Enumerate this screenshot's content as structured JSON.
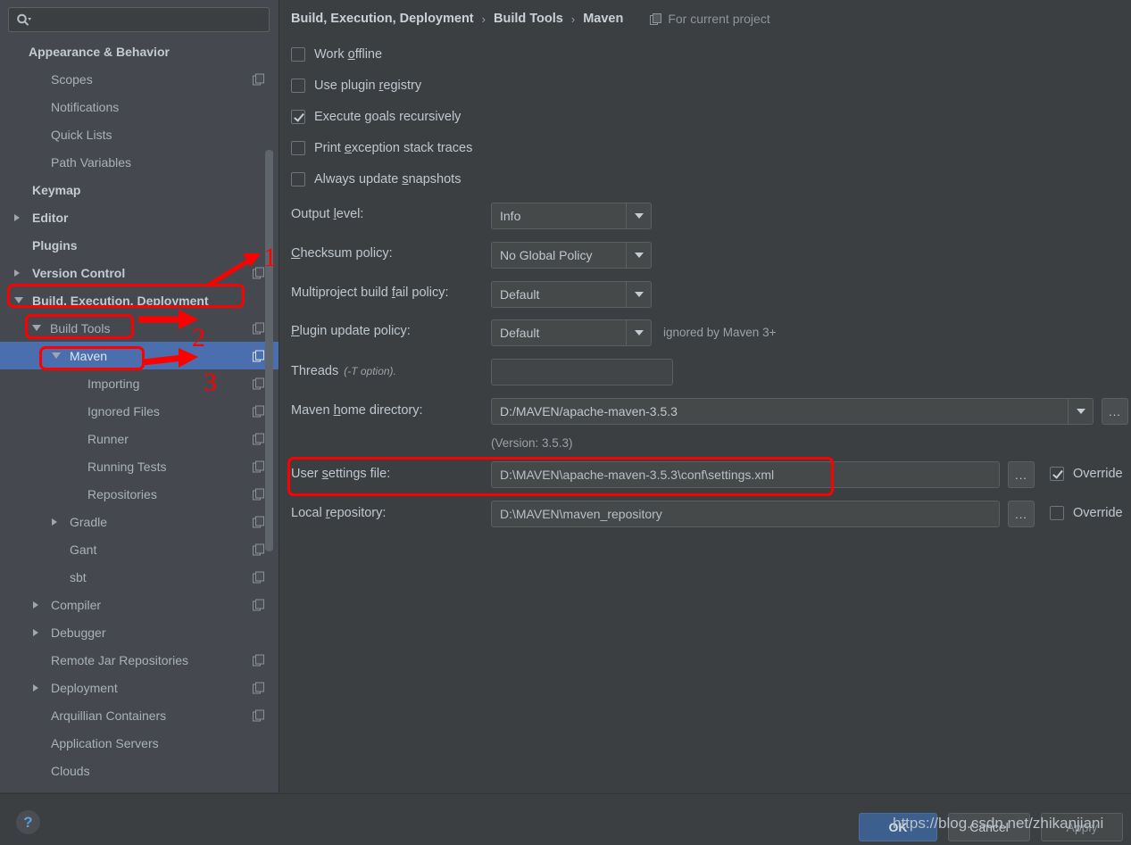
{
  "search": {
    "placeholder": "",
    "value": "",
    "icon": "search-icon"
  },
  "sidebar": {
    "items": [
      {
        "label": "Appearance & Behavior",
        "indent": 32,
        "bold": true,
        "arrow": "none",
        "copy": false
      },
      {
        "label": "Scopes",
        "indent": 57,
        "bold": false,
        "arrow": "none",
        "copy": true
      },
      {
        "label": "Notifications",
        "indent": 57,
        "bold": false,
        "arrow": "none",
        "copy": false
      },
      {
        "label": "Quick Lists",
        "indent": 57,
        "bold": false,
        "arrow": "none",
        "copy": false
      },
      {
        "label": "Path Variables",
        "indent": 57,
        "bold": false,
        "arrow": "none",
        "copy": false
      },
      {
        "label": "Keymap",
        "indent": 36,
        "bold": true,
        "arrow": "none",
        "copy": false
      },
      {
        "label": "Editor",
        "indent": 36,
        "bold": true,
        "arrow": "right",
        "copy": false
      },
      {
        "label": "Plugins",
        "indent": 36,
        "bold": true,
        "arrow": "none",
        "copy": false
      },
      {
        "label": "Version Control",
        "indent": 36,
        "bold": true,
        "arrow": "right",
        "copy": true
      },
      {
        "label": "Build, Execution, Deployment",
        "indent": 36,
        "bold": true,
        "arrow": "down",
        "copy": false
      },
      {
        "label": "Build Tools",
        "indent": 56,
        "bold": false,
        "arrow": "down",
        "copy": true
      },
      {
        "label": "Maven",
        "indent": 78,
        "bold": false,
        "arrow": "down",
        "copy": true,
        "selected": true
      },
      {
        "label": "Importing",
        "indent": 98,
        "bold": false,
        "arrow": "none",
        "copy": true
      },
      {
        "label": "Ignored Files",
        "indent": 98,
        "bold": false,
        "arrow": "none",
        "copy": true
      },
      {
        "label": "Runner",
        "indent": 98,
        "bold": false,
        "arrow": "none",
        "copy": true
      },
      {
        "label": "Running Tests",
        "indent": 98,
        "bold": false,
        "arrow": "none",
        "copy": true
      },
      {
        "label": "Repositories",
        "indent": 98,
        "bold": false,
        "arrow": "none",
        "copy": true
      },
      {
        "label": "Gradle",
        "indent": 78,
        "bold": false,
        "arrow": "right",
        "copy": true
      },
      {
        "label": "Gant",
        "indent": 78,
        "bold": false,
        "arrow": "none",
        "copy": true
      },
      {
        "label": "sbt",
        "indent": 78,
        "bold": false,
        "arrow": "none",
        "copy": true
      },
      {
        "label": "Compiler",
        "indent": 57,
        "bold": false,
        "arrow": "right",
        "copy": true
      },
      {
        "label": "Debugger",
        "indent": 57,
        "bold": false,
        "arrow": "right",
        "copy": false
      },
      {
        "label": "Remote Jar Repositories",
        "indent": 57,
        "bold": false,
        "arrow": "none",
        "copy": true
      },
      {
        "label": "Deployment",
        "indent": 57,
        "bold": false,
        "arrow": "right",
        "copy": true
      },
      {
        "label": "Arquillian Containers",
        "indent": 57,
        "bold": false,
        "arrow": "none",
        "copy": true
      },
      {
        "label": "Application Servers",
        "indent": 57,
        "bold": false,
        "arrow": "none",
        "copy": false
      },
      {
        "label": "Clouds",
        "indent": 57,
        "bold": false,
        "arrow": "none",
        "copy": false
      }
    ]
  },
  "breadcrumb": {
    "crumbs": [
      "Build, Execution, Deployment",
      "Build Tools",
      "Maven"
    ],
    "separator": "›",
    "scope_label": "For current project",
    "scope_icon": "copy-icon"
  },
  "checkboxes": [
    {
      "label_pre": "Work ",
      "mnemonic": "o",
      "label_post": "ffline",
      "checked": false
    },
    {
      "label_pre": "Use plugin ",
      "mnemonic": "r",
      "label_post": "egistry",
      "checked": false
    },
    {
      "label_pre": "Execute ",
      "mnemonic": "g",
      "label_post": "oals recursively",
      "checked": true
    },
    {
      "label_pre": "Print ",
      "mnemonic": "e",
      "label_post": "xception stack traces",
      "checked": false
    },
    {
      "label_pre": "Always update ",
      "mnemonic": "s",
      "label_post": "napshots",
      "checked": false
    }
  ],
  "fields": {
    "output_level": {
      "label_pre": "Output ",
      "mnemonic": "l",
      "label_post": "evel:",
      "value": "Info"
    },
    "checksum_policy": {
      "label_pre": "",
      "mnemonic": "C",
      "label_post": "hecksum policy:",
      "value": "No Global Policy"
    },
    "multiproject_fail_policy": {
      "label_pre": "Multiproject build ",
      "mnemonic": "f",
      "label_post": "ail policy:",
      "value": "Default"
    },
    "plugin_update_policy": {
      "label_pre": "",
      "mnemonic": "P",
      "label_post": "lugin update policy:",
      "value": "Default",
      "note": "ignored by Maven 3+"
    },
    "threads": {
      "label": "Threads",
      "hint": "(-T option).",
      "value": ""
    },
    "maven_home": {
      "label_pre": "Maven ",
      "mnemonic": "h",
      "label_post": "ome directory:",
      "value": "D:/MAVEN/apache-maven-3.5.3",
      "version_note": "(Version: 3.5.3)"
    },
    "user_settings_file": {
      "label_pre": "User ",
      "mnemonic": "s",
      "label_post": "ettings file:",
      "value": "D:\\MAVEN\\apache-maven-3.5.3\\conf\\settings.xml",
      "override_label": "Override",
      "override_checked": true
    },
    "local_repository": {
      "label_pre": "Local ",
      "mnemonic": "r",
      "label_post": "epository:",
      "value": "D:\\MAVEN\\maven_repository",
      "override_label": "Override",
      "override_checked": false
    }
  },
  "browse_button_label": "...",
  "bottom": {
    "help_label": "?",
    "ok_label": "OK",
    "cancel_label": "Cancel",
    "apply_label": "Apply",
    "watermark": "https://blog.csdn.net/zhikanjiani"
  },
  "annotations": {
    "numbers": [
      "1",
      "2",
      "3"
    ],
    "color": "#fd0000"
  }
}
